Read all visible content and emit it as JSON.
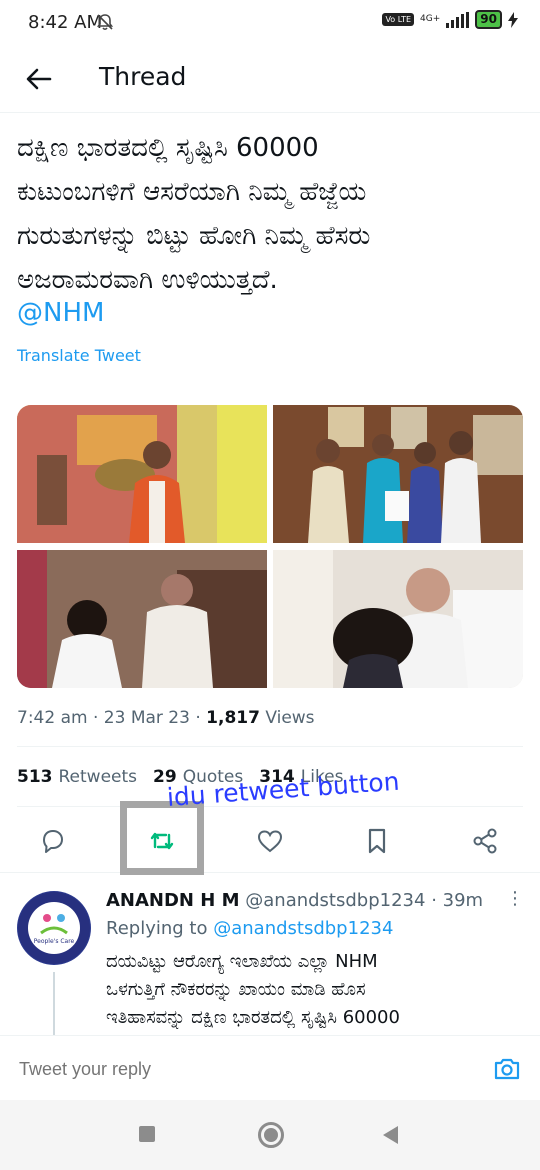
{
  "status_bar": {
    "time": "8:42 AM",
    "network": "4G+",
    "volte": "Vo LTE",
    "battery": "90"
  },
  "header": {
    "title": "Thread"
  },
  "tweet": {
    "text_lines": [
      "ದಕ್ಷಿಣ ಭಾರತದಲ್ಲಿ ಸೃಷ್ಟಿಸಿ 60000",
      "ಕುಟುಂಬಗಳಿಗೆ ಆಸರೆಯಾಗಿ ನಿಮ್ಮ ಹೆಜ್ಜೆಯ",
      "ಗುರುತುಗಳನ್ನು ಬಿಟ್ಟು ಹೋಗಿ ನಿಮ್ಮ ಹೆಸರು",
      "ಅಜರಾಮರವಾಗಿ  ಉಳಿಯುತ್ತದೆ."
    ],
    "mention": "@NHM",
    "translate": "Translate Tweet",
    "time": "7:42 am",
    "date": "23 Mar 23",
    "views_count": "1,817",
    "views_label": "Views",
    "retweets_count": "513",
    "retweets_label": "Retweets",
    "quotes_count": "29",
    "quotes_label": "Quotes",
    "likes_count": "314",
    "likes_label": "Likes"
  },
  "annotation": {
    "text": "idu retweet button"
  },
  "reply": {
    "name": "ANANDN H M",
    "handle": "@anandstsdbp1234",
    "age": "39m",
    "replying_prefix": "Replying to",
    "replying_to": "@anandstsdbp1234",
    "avatar_label_1": "People's Care",
    "text_lines": [
      "ದಯವಿಟ್ಟು ಆರೋಗ್ಯ ಇಲಾಖೆಯ ಎಲ್ಲಾ NHM",
      "ಒಳಗುತ್ತಿಗೆ ನೌಕರರನ್ನು ಖಾಯಂ ಮಾಡಿ ಹೊಸ",
      "ಇತಿಹಾಸವನ್ನು ದಕ್ಷಿಣ ಭಾರತದಲ್ಲಿ ಸೃಷ್ಟಿಸಿ 60000"
    ]
  },
  "compose": {
    "placeholder": "Tweet your reply"
  },
  "colors": {
    "accent": "#1d9bf0",
    "retweet_green": "#00ba7c",
    "annotation_blue": "#2a3cff"
  },
  "icons": [
    "back-arrow-icon",
    "reply-icon",
    "retweet-icon",
    "like-icon",
    "bookmark-icon",
    "share-icon",
    "camera-icon",
    "more-icon"
  ]
}
